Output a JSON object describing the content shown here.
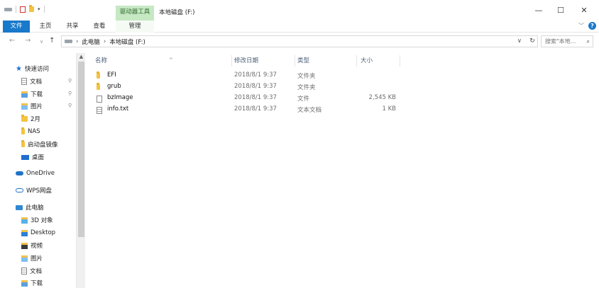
{
  "title_bar": {
    "context_tab_label": "驱动器工具",
    "window_title": "本地磁盘 (F:)",
    "qat_dropdown": "▾",
    "minimize": "—",
    "maximize": "☐",
    "close": "✕"
  },
  "ribbon": {
    "tabs": [
      {
        "label": "文件"
      },
      {
        "label": "主页"
      },
      {
        "label": "共享"
      },
      {
        "label": "查看"
      },
      {
        "label": "管理"
      }
    ],
    "expand_chevron": "﹀",
    "help": "?"
  },
  "address": {
    "back": "←",
    "forward": "→",
    "up": "↑",
    "crumbs": [
      "此电脑",
      "本地磁盘 (F:)"
    ],
    "separator": "›",
    "dropdown": "∨",
    "refresh": "↻",
    "search_placeholder": "搜索\"本地...",
    "search_icon": "⌕"
  },
  "nav_pane": {
    "items": [
      {
        "label": "快速访问",
        "icon": "star-icon"
      },
      {
        "label": "文档",
        "icon": "documents-icon",
        "pinned": true
      },
      {
        "label": "下载",
        "icon": "downloads-icon",
        "pinned": true
      },
      {
        "label": "图片",
        "icon": "pictures-icon",
        "pinned": true
      },
      {
        "label": "2月",
        "icon": "folder-icon"
      },
      {
        "label": "NAS",
        "icon": "folder-icon"
      },
      {
        "label": "启动盘镜像",
        "icon": "folder-icon"
      },
      {
        "label": "桌面",
        "icon": "desktop-icon"
      },
      {
        "label": "OneDrive",
        "icon": "cloud-icon"
      },
      {
        "label": "WPS网盘",
        "icon": "cloud-outline-icon"
      },
      {
        "label": "此电脑",
        "icon": "computer-icon"
      },
      {
        "label": "3D 对象",
        "icon": "3d-objects-icon"
      },
      {
        "label": "Desktop",
        "icon": "desktop-folder-icon"
      },
      {
        "label": "视频",
        "icon": "videos-icon"
      },
      {
        "label": "图片",
        "icon": "pictures-icon"
      },
      {
        "label": "文档",
        "icon": "documents-icon"
      },
      {
        "label": "下载",
        "icon": "downloads-icon"
      }
    ],
    "pin_glyph": "📌",
    "scroll_up": "▲"
  },
  "file_list": {
    "columns": {
      "name": "名称",
      "modified": "修改日期",
      "type": "类型",
      "size": "大小"
    },
    "sort_indicator": "^",
    "rows": [
      {
        "name": "EFI",
        "modified": "2018/8/1 9:37",
        "type": "文件夹",
        "size": "",
        "icon": "folder-icon"
      },
      {
        "name": "grub",
        "modified": "2018/8/1 9:37",
        "type": "文件夹",
        "size": "",
        "icon": "folder-icon"
      },
      {
        "name": "bzImage",
        "modified": "2018/8/1 9:37",
        "type": "文件",
        "size": "2,545 KB",
        "icon": "file-icon"
      },
      {
        "name": "info.txt",
        "modified": "2018/8/1 9:37",
        "type": "文本文档",
        "size": "1 KB",
        "icon": "text-file-icon"
      }
    ]
  },
  "colors": {
    "accent": "#1979ca",
    "context_tab_bg": "#c6e8c3",
    "folder": "#f5c342"
  }
}
